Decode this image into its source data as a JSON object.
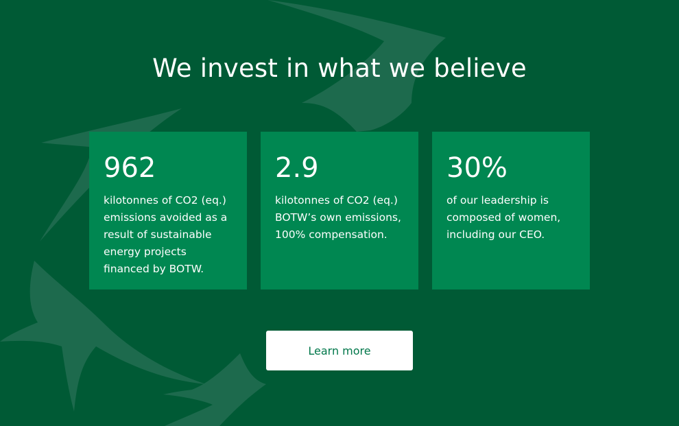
{
  "heading": "We invest in what we believe",
  "cards": [
    {
      "stat": "962",
      "description": "kilotonnes of CO2 (eq.) emissions avoided as a result of sustainable energy projects financed by BOTW."
    },
    {
      "stat": "2.9",
      "description": "kilotonnes of CO2 (eq.) BOTW’s own emissions, 100% compensation."
    },
    {
      "stat": "30%",
      "description": "of our leadership is composed of women, including our CEO."
    }
  ],
  "cta": {
    "label": "Learn more"
  },
  "colors": {
    "background": "#005a35",
    "card": "#008751",
    "decoration": "#1d6a4d",
    "button_text": "#00774a"
  },
  "decoration_icon": "bird-logo-watermark"
}
